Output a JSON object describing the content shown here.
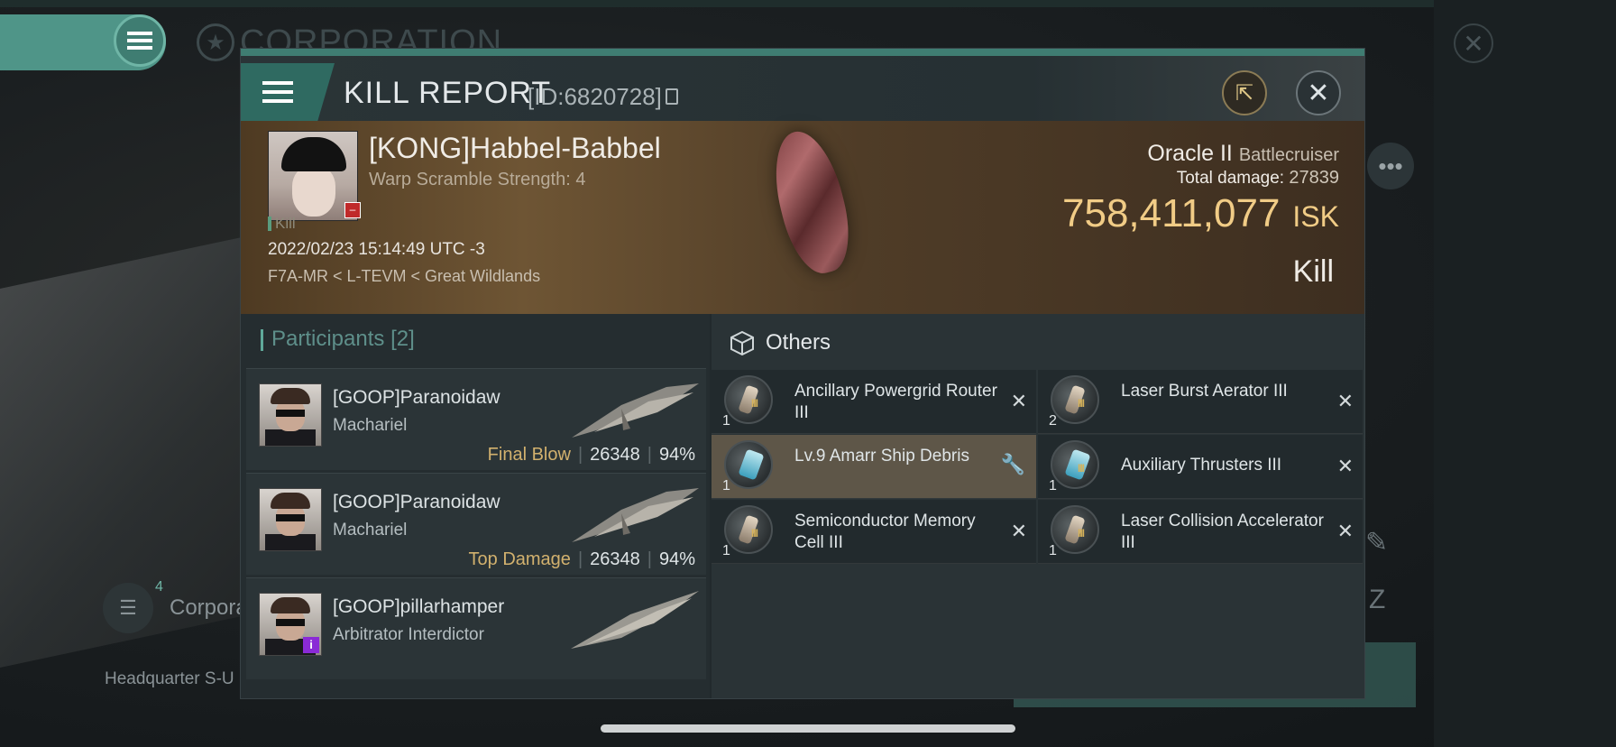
{
  "background": {
    "corp_title": "CORPORATION",
    "corp_row_label": "Corpora",
    "corp_row_badge": "4",
    "hq_label": "Headquarter S-U"
  },
  "header": {
    "title": "KILL REPORT",
    "id_label": "[ID:6820728]"
  },
  "victim": {
    "name": "[KONG]Habbel-Babbel",
    "sub": "Warp Scramble Strength: 4",
    "kill_tag": "Kill",
    "time": "2022/02/23 15:14:49 UTC -3",
    "location": "F7A-MR < L-TEVM < Great Wildlands",
    "ship_name": "Oracle II",
    "ship_class": "Battlecruiser",
    "total_damage_label": "Total damage:",
    "total_damage": "27839",
    "isk_value": "758,411,077",
    "isk_unit": "ISK",
    "result": "Kill"
  },
  "participants": {
    "title": "Participants",
    "count": "[2]",
    "items": [
      {
        "name": "[GOOP]Paranoidaw",
        "ship": "Machariel",
        "role": "Final Blow",
        "damage": "26348",
        "percent": "94%"
      },
      {
        "name": "[GOOP]Paranoidaw",
        "ship": "Machariel",
        "role": "Top Damage",
        "damage": "26348",
        "percent": "94%"
      },
      {
        "name": "[GOOP]pillarhamper",
        "ship": "Arbitrator Interdictor"
      }
    ]
  },
  "others": {
    "title": "Others",
    "items": [
      {
        "name": "Ancillary Powergrid Router III",
        "qty": "1",
        "tier": "III"
      },
      {
        "name": "Laser Burst Aerator III",
        "qty": "2",
        "tier": "III"
      },
      {
        "name": "Lv.9 Amarr Ship Debris",
        "qty": "1",
        "tier": ""
      },
      {
        "name": "Auxiliary Thrusters III",
        "qty": "1",
        "tier": "III"
      },
      {
        "name": "Semiconductor Memory Cell III",
        "qty": "1",
        "tier": "III"
      },
      {
        "name": "Laser Collision Accelerator III",
        "qty": "1",
        "tier": "III"
      }
    ]
  },
  "icons": {
    "close": "✕",
    "share": "⇱",
    "more": "•••",
    "wrench": "🔧"
  }
}
